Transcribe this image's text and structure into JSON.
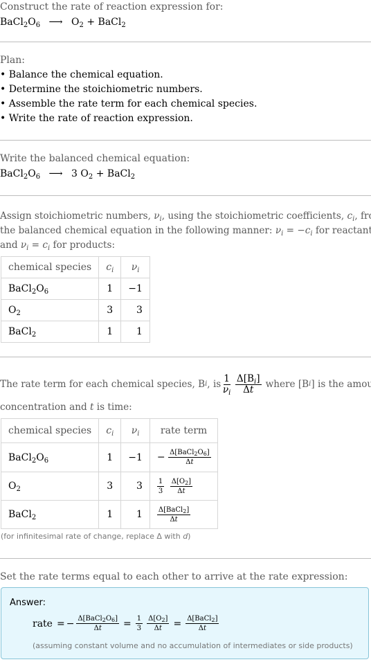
{
  "intro": {
    "heading": "Construct the rate of reaction expression for:",
    "reaction": {
      "reactant": {
        "base": "BaCl",
        "sub1": "2",
        "mid": "O",
        "sub2": "6"
      },
      "arrow": "⟶",
      "product1": {
        "base": "O",
        "sub": "2"
      },
      "plus": "+",
      "product2": {
        "base": "BaCl",
        "sub": "2"
      }
    }
  },
  "plan": {
    "heading": "Plan:",
    "items": [
      "• Balance the chemical equation.",
      "• Determine the stoichiometric numbers.",
      "• Assemble the rate term for each chemical species.",
      "• Write the rate of reaction expression."
    ]
  },
  "balanced": {
    "heading": "Write the balanced chemical equation:",
    "coef_o2": "3"
  },
  "stoich": {
    "text_line1_a": "Assign stoichiometric numbers, ",
    "text_line1_b": ", using the stoichiometric coefficients, ",
    "text_line1_c": ", from",
    "text_line2_a": "the balanced chemical equation in the following manner: ",
    "text_line2_b": " for reactants",
    "text_line3_a": "and ",
    "text_line3_b": " for products:",
    "nu_i": "νi",
    "c_i": "ci",
    "table": {
      "headers": [
        "chemical species",
        "c",
        "ν"
      ],
      "rows": [
        {
          "species": "BaCl2O6",
          "c": "1",
          "nu": "−1"
        },
        {
          "species": "O2",
          "c": "3",
          "nu": "3"
        },
        {
          "species": "BaCl2",
          "c": "1",
          "nu": "1"
        }
      ]
    }
  },
  "rate_terms": {
    "text_a": "The rate term for each chemical species, B",
    "text_b": ", is ",
    "text_c": " where [B",
    "text_d": "] is the amount",
    "text_line2_a": "concentration and ",
    "text_line2_t": "t",
    "text_line2_b": " is time:",
    "table": {
      "headers": [
        "chemical species",
        "c",
        "ν",
        "rate term"
      ],
      "rows": [
        {
          "species": "BaCl2O6",
          "c": "1",
          "nu": "−1",
          "term": "−Δ[BaCl2O6]/Δt"
        },
        {
          "species": "O2",
          "c": "3",
          "nu": "3",
          "term": "(1/3) Δ[O2]/Δt"
        },
        {
          "species": "BaCl2",
          "c": "1",
          "nu": "1",
          "term": "Δ[BaCl2]/Δt"
        }
      ]
    },
    "note_a": "(for infinitesimal rate of change, replace Δ with ",
    "note_d": "d",
    "note_b": ")"
  },
  "final": {
    "heading": "Set the rate terms equal to each other to arrive at the rate expression:",
    "answer_label": "Answer:",
    "rate_word": "rate",
    "assumption": "(assuming constant volume and no accumulation of intermediates or side products)"
  },
  "symbols": {
    "delta": "Δ",
    "minus": "−",
    "equals": "=",
    "one": "1",
    "three": "3",
    "dt": "Δt"
  },
  "colors": {
    "answer_bg": "#e6f7fd",
    "answer_border": "#86c4d8",
    "divider": "#bdbdbd"
  }
}
